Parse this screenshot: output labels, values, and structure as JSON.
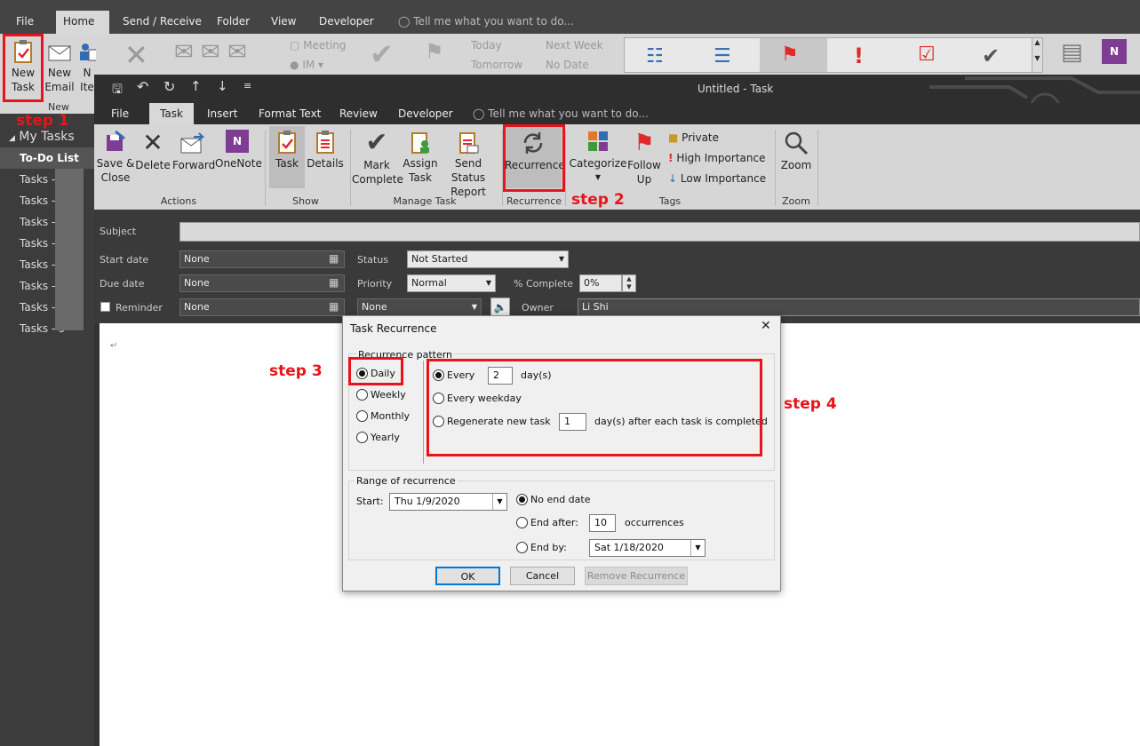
{
  "main": {
    "tabs": [
      "File",
      "Home",
      "Send / Receive",
      "Folder",
      "View",
      "Developer"
    ],
    "tell_me": "Tell me what you want to do...",
    "ribbon": {
      "new_task": [
        "New",
        "Task"
      ],
      "new_email": [
        "New",
        "Email"
      ],
      "new_items": [
        "N",
        "Ite"
      ],
      "group_new": "New",
      "meeting": "Meeting",
      "im": "IM",
      "today": "Today",
      "tomorrow": "Tomorrow",
      "next_week": "Next Week",
      "no_date": "No Date"
    }
  },
  "sidebar": {
    "header": "My Tasks",
    "items": [
      "To-Do List",
      "Tasks - l",
      "Tasks - ",
      "Tasks - ",
      "Tasks - a",
      "Tasks - s",
      "Tasks - t",
      "Tasks - t",
      "Tasks - s"
    ]
  },
  "task_window": {
    "title": "Untitled - Task",
    "tabs": [
      "File",
      "Task",
      "Insert",
      "Format Text",
      "Review",
      "Developer"
    ],
    "tell_me": "Tell me what you want to do...",
    "ribbon": {
      "save_close": [
        "Save &",
        "Close"
      ],
      "delete": "Delete",
      "forward": "Forward",
      "onenote": "OneNote",
      "group_actions": "Actions",
      "task": "Task",
      "details": "Details",
      "group_show": "Show",
      "mark_complete": [
        "Mark",
        "Complete"
      ],
      "assign_task": [
        "Assign",
        "Task"
      ],
      "send_status": [
        "Send Status",
        "Report"
      ],
      "group_manage": "Manage Task",
      "recurrence": "Recurrence",
      "group_recurrence": "Recurrence",
      "categorize": "Categorize",
      "follow_up": [
        "Follow",
        "Up"
      ],
      "private": "Private",
      "high_importance": "High Importance",
      "low_importance": "Low Importance",
      "group_tags": "Tags",
      "zoom": "Zoom",
      "group_zoom": "Zoom"
    },
    "form": {
      "subject_label": "Subject",
      "start_label": "Start date",
      "start_value": "None",
      "due_label": "Due date",
      "due_value": "None",
      "reminder_label": "Reminder",
      "reminder_value": "None",
      "reminder_time": "None",
      "status_label": "Status",
      "status_value": "Not Started",
      "priority_label": "Priority",
      "priority_value": "Normal",
      "complete_label": "% Complete",
      "complete_value": "0%",
      "owner_label": "Owner",
      "owner_value": "Li Shi"
    },
    "body_mark": "↵"
  },
  "dialog": {
    "title": "Task Recurrence",
    "pattern_label": "Recurrence pattern",
    "daily": "Daily",
    "weekly": "Weekly",
    "monthly": "Monthly",
    "yearly": "Yearly",
    "every": "Every",
    "every_value": "2",
    "days": "day(s)",
    "every_weekday": "Every weekday",
    "regenerate": "Regenerate new task",
    "regenerate_value": "1",
    "regenerate_suffix": "day(s) after each task is completed",
    "range_label": "Range of recurrence",
    "start_label": "Start:",
    "start_value": "Thu 1/9/2020",
    "no_end": "No end date",
    "end_after": "End after:",
    "end_after_value": "10",
    "occurrences": "occurrences",
    "end_by": "End by:",
    "end_by_value": "Sat 1/18/2020",
    "ok": "OK",
    "cancel": "Cancel",
    "remove": "Remove Recurrence"
  },
  "steps": [
    "step 1",
    "step 2",
    "step 3",
    "step 4"
  ],
  "colors": {
    "annotation": "#e8141b",
    "ribbon": "#d6d6d6",
    "dark": "#3b3b3b"
  }
}
